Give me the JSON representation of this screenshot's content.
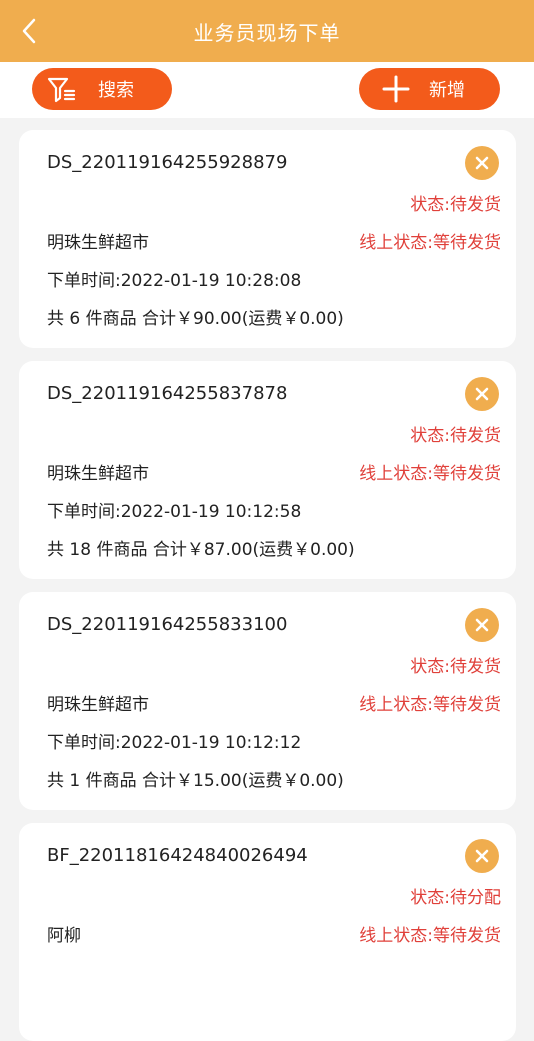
{
  "header": {
    "title": "业务员现场下单"
  },
  "toolbar": {
    "search_label": "搜索",
    "add_label": "新增"
  },
  "orders": [
    {
      "order_no": "DS_220119164255928879",
      "status": "状态:待发货",
      "shop": "明珠生鲜超市",
      "online_status": "线上状态:等待发货",
      "order_time": "下单时间:2022-01-19 10:28:08",
      "summary": "共 6 件商品 合计￥90.00(运费￥0.00)"
    },
    {
      "order_no": "DS_220119164255837878",
      "status": "状态:待发货",
      "shop": "明珠生鲜超市",
      "online_status": "线上状态:等待发货",
      "order_time": "下单时间:2022-01-19 10:12:58",
      "summary": "共 18 件商品 合计￥87.00(运费￥0.00)"
    },
    {
      "order_no": "DS_220119164255833100",
      "status": "状态:待发货",
      "shop": "明珠生鲜超市",
      "online_status": "线上状态:等待发货",
      "order_time": "下单时间:2022-01-19 10:12:12",
      "summary": "共 1 件商品 合计￥15.00(运费￥0.00)"
    },
    {
      "order_no": "BF_220118164248400264​94",
      "status": "状态:待分配",
      "shop": "阿柳",
      "online_status": "线上状态:等待发货",
      "order_time": "",
      "summary": ""
    }
  ],
  "colors": {
    "header": "#f0ad4e",
    "button": "#f35b1b",
    "status_red": "#e0403a"
  }
}
